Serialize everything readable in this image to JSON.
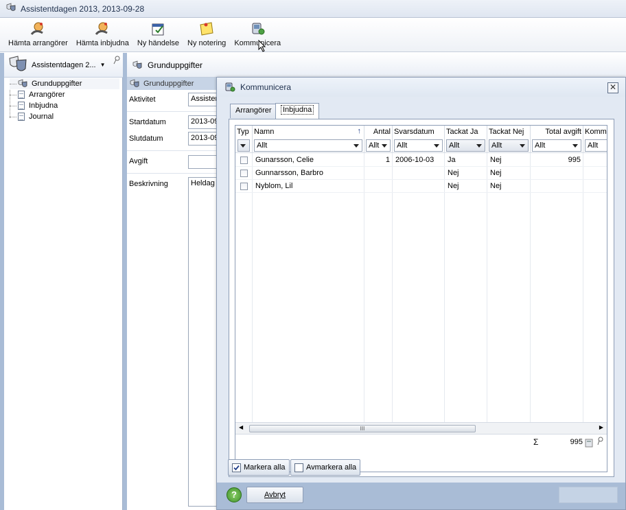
{
  "window": {
    "title": "Assistentdagen 2013, 2013-09-28"
  },
  "toolbar": {
    "buttons": [
      {
        "label": "Hämta arrangörer",
        "icon": "fetch-organizers-icon"
      },
      {
        "label": "Hämta inbjudna",
        "icon": "fetch-invited-icon"
      },
      {
        "label": "Ny händelse",
        "icon": "new-event-icon"
      },
      {
        "label": "Ny notering",
        "icon": "new-note-icon"
      },
      {
        "label": "Kommunicera",
        "icon": "communicate-icon"
      }
    ]
  },
  "left": {
    "selector": "Assistentdagen 2...",
    "tree": [
      "Grunduppgifter",
      "Arrangörer",
      "Inbjudna",
      "Journal"
    ]
  },
  "middle": {
    "header": "Grunduppgifter",
    "subheader": "Grunduppgifter",
    "fields": {
      "aktivitet_label": "Aktivitet",
      "aktivitet_value": "Assisten",
      "startdatum_label": "Startdatum",
      "startdatum_value": "2013-09",
      "slutdatum_label": "Slutdatum",
      "slutdatum_value": "2013-09",
      "avgift_label": "Avgift",
      "avgift_value": "",
      "beskrivning_label": "Beskrivning",
      "beskrivning_value": "Heldag n"
    }
  },
  "dialog": {
    "title": "Kommunicera",
    "tabs": [
      "Arrangörer",
      "Inbjudna"
    ],
    "active_tab": "Inbjudna",
    "columns": [
      "Typ",
      "Namn",
      "Antal",
      "Svarsdatum",
      "Tackat Ja",
      "Tackat Nej",
      "Total avgift",
      "Komme"
    ],
    "filters": {
      "namn": "Allt",
      "antal": "Allt",
      "svarsdatum": "Allt",
      "tackat_ja": "Allt",
      "tackat_nej": "Allt",
      "total_avgift": "Allt",
      "komme": "Allt"
    },
    "rows": [
      {
        "namn": "Gunarsson, Celie",
        "antal": "1",
        "svarsdatum": "2006-10-03",
        "tackat_ja": "Ja",
        "tackat_nej": "Nej",
        "total_avgift": "995"
      },
      {
        "namn": "Gunnarsson, Barbro",
        "antal": "",
        "svarsdatum": "",
        "tackat_ja": "Nej",
        "tackat_nej": "Nej",
        "total_avgift": ""
      },
      {
        "namn": "Nyblom, Lil",
        "antal": "",
        "svarsdatum": "",
        "tackat_ja": "Nej",
        "tackat_nej": "Nej",
        "total_avgift": ""
      }
    ],
    "scroll_thumb": "III",
    "summary": {
      "sigma": "Σ",
      "total": "995"
    },
    "buttons": {
      "mark_all": "Markera alla",
      "unmark_all": "Avmarkera alla",
      "cancel": "Avbryt",
      "help": "?"
    }
  },
  "colors": {
    "frame": "#a9bcd6",
    "accent": "#1e2f4c"
  }
}
